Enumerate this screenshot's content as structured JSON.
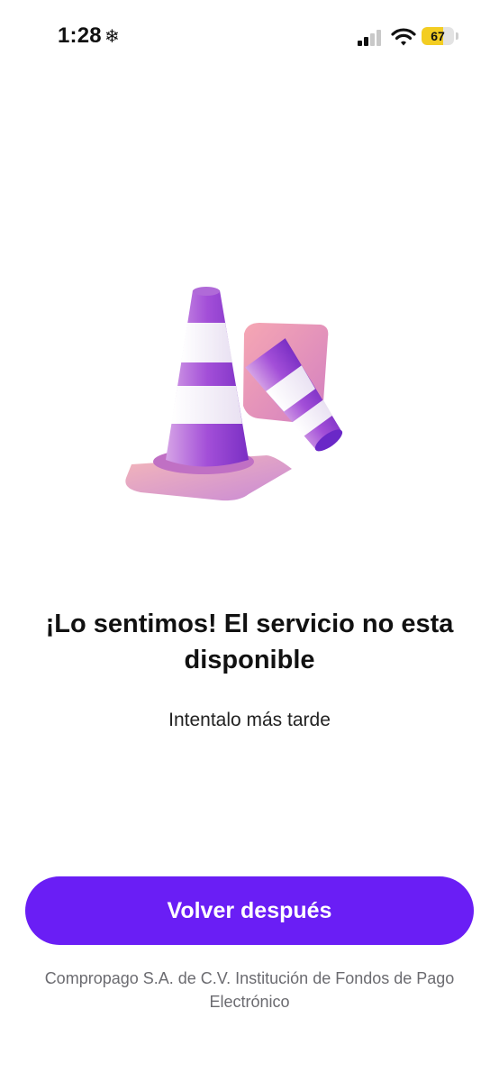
{
  "status_bar": {
    "time": "1:28",
    "extra_icon": "❄",
    "battery_percent": "67",
    "battery_level": 0.67,
    "signal_icon": "cellular-signal-icon",
    "wifi_icon": "wifi-icon"
  },
  "illustration": {
    "icon": "traffic-cones-illustration"
  },
  "content": {
    "title": "¡Lo sentimos! El servicio no esta disponible",
    "subtitle": "Intentalo más tarde"
  },
  "actions": {
    "primary_label": "Volver después"
  },
  "footer": {
    "legal_text": "Compropago S.A. de C.V. Institución de Fondos de Pago Electrónico"
  },
  "colors": {
    "accent": "#6a1ef5",
    "battery": "#f3cd22",
    "cone_purple": "#8b3fd9",
    "cone_pink": "#e8a3c6"
  }
}
